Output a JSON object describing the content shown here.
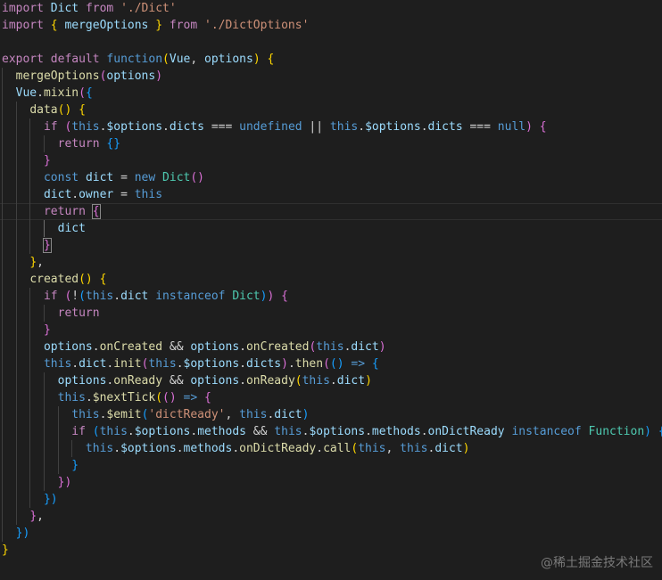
{
  "editor": {
    "watermark": "@稀土掘金技术社区",
    "lines": [
      [
        [
          "kw",
          "import"
        ],
        [
          "pl",
          " "
        ],
        [
          "id",
          "Dict"
        ],
        [
          "pl",
          " "
        ],
        [
          "kw",
          "from"
        ],
        [
          "pl",
          " "
        ],
        [
          "str",
          "'./Dict'"
        ]
      ],
      [
        [
          "kw",
          "import"
        ],
        [
          "pl",
          " "
        ],
        [
          "b1",
          "{"
        ],
        [
          "pl",
          " "
        ],
        [
          "id",
          "mergeOptions"
        ],
        [
          "pl",
          " "
        ],
        [
          "b1",
          "}"
        ],
        [
          "pl",
          " "
        ],
        [
          "kw",
          "from"
        ],
        [
          "pl",
          " "
        ],
        [
          "str",
          "'./DictOptions'"
        ]
      ],
      [],
      [
        [
          "kw",
          "export"
        ],
        [
          "pl",
          " "
        ],
        [
          "kw",
          "default"
        ],
        [
          "pl",
          " "
        ],
        [
          "st",
          "function"
        ],
        [
          "b1",
          "("
        ],
        [
          "id",
          "Vue"
        ],
        [
          "pl",
          ", "
        ],
        [
          "id",
          "options"
        ],
        [
          "b1",
          ")"
        ],
        [
          "pl",
          " "
        ],
        [
          "b1",
          "{"
        ]
      ],
      [
        [
          "pl",
          "  "
        ],
        [
          "fn",
          "mergeOptions"
        ],
        [
          "b2",
          "("
        ],
        [
          "id",
          "options"
        ],
        [
          "b2",
          ")"
        ]
      ],
      [
        [
          "pl",
          "  "
        ],
        [
          "id",
          "Vue"
        ],
        [
          "pl",
          "."
        ],
        [
          "fn",
          "mixin"
        ],
        [
          "b2",
          "("
        ],
        [
          "b3",
          "{"
        ]
      ],
      [
        [
          "pl",
          "    "
        ],
        [
          "fn",
          "data"
        ],
        [
          "b1",
          "()"
        ],
        [
          "pl",
          " "
        ],
        [
          "b1",
          "{"
        ]
      ],
      [
        [
          "pl",
          "      "
        ],
        [
          "kw",
          "if"
        ],
        [
          "pl",
          " "
        ],
        [
          "b2",
          "("
        ],
        [
          "st",
          "this"
        ],
        [
          "pl",
          "."
        ],
        [
          "id",
          "$options"
        ],
        [
          "pl",
          "."
        ],
        [
          "id",
          "dicts"
        ],
        [
          "pl",
          " === "
        ],
        [
          "st",
          "undefined"
        ],
        [
          "pl",
          " || "
        ],
        [
          "st",
          "this"
        ],
        [
          "pl",
          "."
        ],
        [
          "id",
          "$options"
        ],
        [
          "pl",
          "."
        ],
        [
          "id",
          "dicts"
        ],
        [
          "pl",
          " === "
        ],
        [
          "st",
          "null"
        ],
        [
          "b2",
          ")"
        ],
        [
          "pl",
          " "
        ],
        [
          "b2",
          "{"
        ]
      ],
      [
        [
          "pl",
          "        "
        ],
        [
          "kw",
          "return"
        ],
        [
          "pl",
          " "
        ],
        [
          "b3",
          "{}"
        ]
      ],
      [
        [
          "pl",
          "      "
        ],
        [
          "b2",
          "}"
        ]
      ],
      [
        [
          "pl",
          "      "
        ],
        [
          "st",
          "const"
        ],
        [
          "pl",
          " "
        ],
        [
          "id",
          "dict"
        ],
        [
          "pl",
          " = "
        ],
        [
          "st",
          "new"
        ],
        [
          "pl",
          " "
        ],
        [
          "ty",
          "Dict"
        ],
        [
          "b2",
          "()"
        ]
      ],
      [
        [
          "pl",
          "      "
        ],
        [
          "id",
          "dict"
        ],
        [
          "pl",
          "."
        ],
        [
          "id",
          "owner"
        ],
        [
          "pl",
          " = "
        ],
        [
          "st",
          "this"
        ]
      ],
      [
        [
          "pl",
          "      "
        ],
        [
          "kw",
          "return"
        ],
        [
          "pl",
          " "
        ],
        [
          "b2",
          "{"
        ]
      ],
      [
        [
          "pl",
          "        "
        ],
        [
          "id",
          "dict"
        ]
      ],
      [
        [
          "pl",
          "      "
        ],
        [
          "b2",
          "}"
        ]
      ],
      [
        [
          "pl",
          "    "
        ],
        [
          "b1",
          "}"
        ],
        [
          "pl",
          ","
        ]
      ],
      [
        [
          "pl",
          "    "
        ],
        [
          "fn",
          "created"
        ],
        [
          "b1",
          "()"
        ],
        [
          "pl",
          " "
        ],
        [
          "b1",
          "{"
        ]
      ],
      [
        [
          "pl",
          "      "
        ],
        [
          "kw",
          "if"
        ],
        [
          "pl",
          " "
        ],
        [
          "b2",
          "("
        ],
        [
          "pl",
          "!"
        ],
        [
          "b3",
          "("
        ],
        [
          "st",
          "this"
        ],
        [
          "pl",
          "."
        ],
        [
          "id",
          "dict"
        ],
        [
          "pl",
          " "
        ],
        [
          "st",
          "instanceof"
        ],
        [
          "pl",
          " "
        ],
        [
          "ty",
          "Dict"
        ],
        [
          "b3",
          ")"
        ],
        [
          "b2",
          ")"
        ],
        [
          "pl",
          " "
        ],
        [
          "b2",
          "{"
        ]
      ],
      [
        [
          "pl",
          "        "
        ],
        [
          "kw",
          "return"
        ]
      ],
      [
        [
          "pl",
          "      "
        ],
        [
          "b2",
          "}"
        ]
      ],
      [
        [
          "pl",
          "      "
        ],
        [
          "id",
          "options"
        ],
        [
          "pl",
          "."
        ],
        [
          "fn",
          "onCreated"
        ],
        [
          "pl",
          " && "
        ],
        [
          "id",
          "options"
        ],
        [
          "pl",
          "."
        ],
        [
          "fn",
          "onCreated"
        ],
        [
          "b2",
          "("
        ],
        [
          "st",
          "this"
        ],
        [
          "pl",
          "."
        ],
        [
          "id",
          "dict"
        ],
        [
          "b2",
          ")"
        ]
      ],
      [
        [
          "pl",
          "      "
        ],
        [
          "st",
          "this"
        ],
        [
          "pl",
          "."
        ],
        [
          "id",
          "dict"
        ],
        [
          "pl",
          "."
        ],
        [
          "fn",
          "init"
        ],
        [
          "b2",
          "("
        ],
        [
          "st",
          "this"
        ],
        [
          "pl",
          "."
        ],
        [
          "id",
          "$options"
        ],
        [
          "pl",
          "."
        ],
        [
          "id",
          "dicts"
        ],
        [
          "b2",
          ")"
        ],
        [
          "pl",
          "."
        ],
        [
          "fn",
          "then"
        ],
        [
          "b2",
          "("
        ],
        [
          "b3",
          "()"
        ],
        [
          "pl",
          " "
        ],
        [
          "st",
          "=>"
        ],
        [
          "pl",
          " "
        ],
        [
          "b3",
          "{"
        ]
      ],
      [
        [
          "pl",
          "        "
        ],
        [
          "id",
          "options"
        ],
        [
          "pl",
          "."
        ],
        [
          "fn",
          "onReady"
        ],
        [
          "pl",
          " && "
        ],
        [
          "id",
          "options"
        ],
        [
          "pl",
          "."
        ],
        [
          "fn",
          "onReady"
        ],
        [
          "b1",
          "("
        ],
        [
          "st",
          "this"
        ],
        [
          "pl",
          "."
        ],
        [
          "id",
          "dict"
        ],
        [
          "b1",
          ")"
        ]
      ],
      [
        [
          "pl",
          "        "
        ],
        [
          "st",
          "this"
        ],
        [
          "pl",
          "."
        ],
        [
          "fn",
          "$nextTick"
        ],
        [
          "b1",
          "("
        ],
        [
          "b2",
          "()"
        ],
        [
          "pl",
          " "
        ],
        [
          "st",
          "=>"
        ],
        [
          "pl",
          " "
        ],
        [
          "b2",
          "{"
        ]
      ],
      [
        [
          "pl",
          "          "
        ],
        [
          "st",
          "this"
        ],
        [
          "pl",
          "."
        ],
        [
          "fn",
          "$emit"
        ],
        [
          "b3",
          "("
        ],
        [
          "str",
          "'dictReady'"
        ],
        [
          "pl",
          ", "
        ],
        [
          "st",
          "this"
        ],
        [
          "pl",
          "."
        ],
        [
          "id",
          "dict"
        ],
        [
          "b3",
          ")"
        ]
      ],
      [
        [
          "pl",
          "          "
        ],
        [
          "kw",
          "if"
        ],
        [
          "pl",
          " "
        ],
        [
          "b3",
          "("
        ],
        [
          "st",
          "this"
        ],
        [
          "pl",
          "."
        ],
        [
          "id",
          "$options"
        ],
        [
          "pl",
          "."
        ],
        [
          "id",
          "methods"
        ],
        [
          "pl",
          " && "
        ],
        [
          "st",
          "this"
        ],
        [
          "pl",
          "."
        ],
        [
          "id",
          "$options"
        ],
        [
          "pl",
          "."
        ],
        [
          "id",
          "methods"
        ],
        [
          "pl",
          "."
        ],
        [
          "id",
          "onDictReady"
        ],
        [
          "pl",
          " "
        ],
        [
          "st",
          "instanceof"
        ],
        [
          "pl",
          " "
        ],
        [
          "ty",
          "Function"
        ],
        [
          "b3",
          ")"
        ],
        [
          "pl",
          " "
        ],
        [
          "b3",
          "{"
        ]
      ],
      [
        [
          "pl",
          "            "
        ],
        [
          "st",
          "this"
        ],
        [
          "pl",
          "."
        ],
        [
          "id",
          "$options"
        ],
        [
          "pl",
          "."
        ],
        [
          "id",
          "methods"
        ],
        [
          "pl",
          "."
        ],
        [
          "fn",
          "onDictReady"
        ],
        [
          "pl",
          "."
        ],
        [
          "fn",
          "call"
        ],
        [
          "b1",
          "("
        ],
        [
          "st",
          "this"
        ],
        [
          "pl",
          ", "
        ],
        [
          "st",
          "this"
        ],
        [
          "pl",
          "."
        ],
        [
          "id",
          "dict"
        ],
        [
          "b1",
          ")"
        ]
      ],
      [
        [
          "pl",
          "          "
        ],
        [
          "b3",
          "}"
        ]
      ],
      [
        [
          "pl",
          "        "
        ],
        [
          "b2",
          "})"
        ]
      ],
      [
        [
          "pl",
          "      "
        ],
        [
          "b3",
          "})"
        ]
      ],
      [
        [
          "pl",
          "    "
        ],
        [
          "b2",
          "}"
        ],
        [
          "pl",
          ","
        ]
      ],
      [
        [
          "pl",
          "  "
        ],
        [
          "b3",
          "})"
        ]
      ],
      [
        [
          "b1",
          "}"
        ]
      ]
    ]
  }
}
